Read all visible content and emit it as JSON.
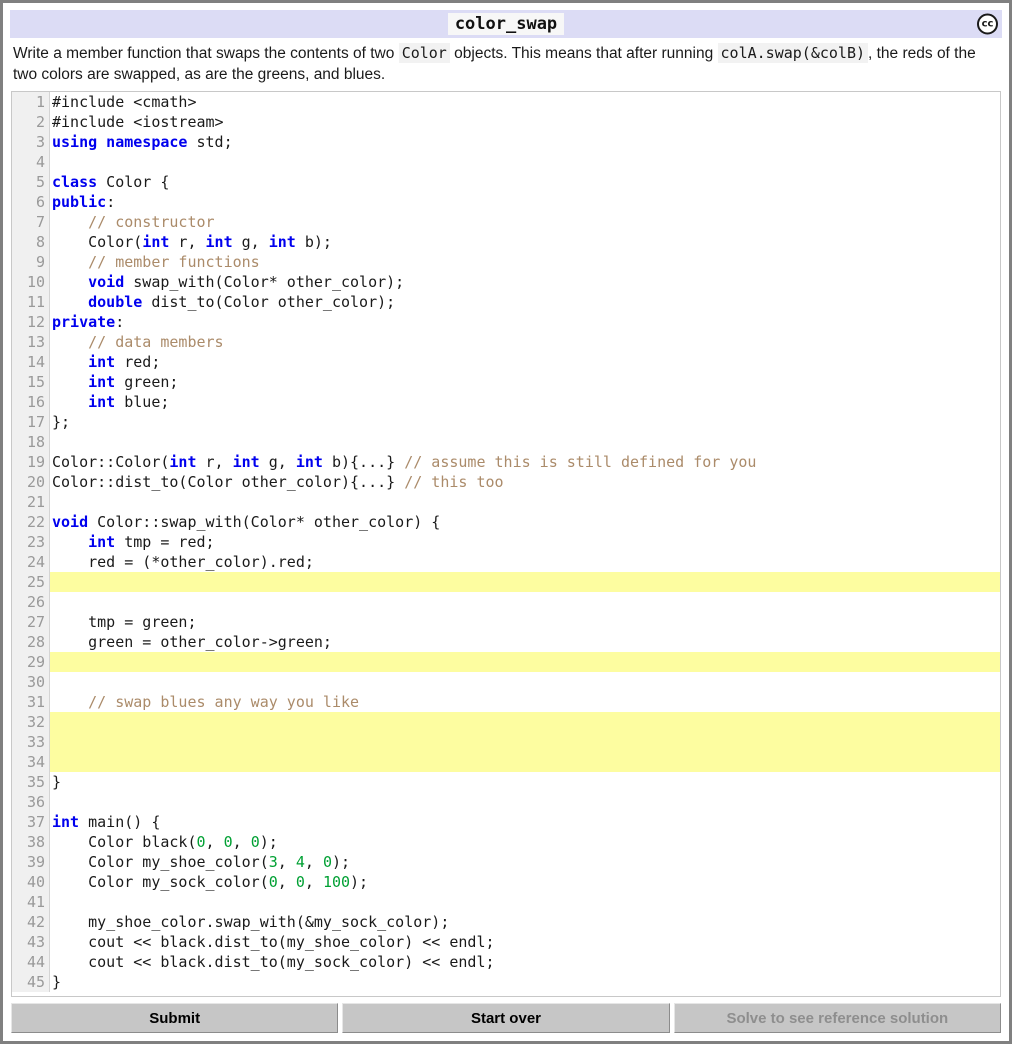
{
  "window": {
    "title": "color_swap",
    "license_badge": "cc"
  },
  "prompt": {
    "part1": "Write a member function that swaps the contents of two ",
    "code1": "Color",
    "part2": " objects. This means that after running ",
    "code2": "colA.swap(&colB)",
    "part3": ", the reds of the two colors are swapped, as are the greens, and blues."
  },
  "editor": {
    "language": "cpp",
    "first_line_number": 1,
    "total_lines": 45,
    "highlighted_lines": [
      25,
      29,
      32,
      33,
      34
    ],
    "highlight_color": "#fdfda0",
    "colors": {
      "keyword": "#0000ee",
      "comment": "#ab8b6a",
      "number": "#00a033",
      "plain": "#1a1a1a",
      "gutter_bg": "#f0f0f0",
      "gutter_fg": "#999999"
    },
    "lines": [
      {
        "n": 1,
        "editable": false,
        "tokens": [
          {
            "t": "pln",
            "v": "#include <cmath>"
          }
        ]
      },
      {
        "n": 2,
        "editable": false,
        "tokens": [
          {
            "t": "pln",
            "v": "#include <iostream>"
          }
        ]
      },
      {
        "n": 3,
        "editable": false,
        "tokens": [
          {
            "t": "kw",
            "v": "using namespace"
          },
          {
            "t": "pln",
            "v": " std;"
          }
        ]
      },
      {
        "n": 4,
        "editable": false,
        "tokens": []
      },
      {
        "n": 5,
        "editable": false,
        "tokens": [
          {
            "t": "kw",
            "v": "class"
          },
          {
            "t": "pln",
            "v": " Color {"
          }
        ]
      },
      {
        "n": 6,
        "editable": false,
        "tokens": [
          {
            "t": "kw",
            "v": "public"
          },
          {
            "t": "pln",
            "v": ":"
          }
        ]
      },
      {
        "n": 7,
        "editable": false,
        "tokens": [
          {
            "t": "pln",
            "v": "    "
          },
          {
            "t": "com",
            "v": "// constructor"
          }
        ]
      },
      {
        "n": 8,
        "editable": false,
        "tokens": [
          {
            "t": "pln",
            "v": "    Color("
          },
          {
            "t": "kw",
            "v": "int"
          },
          {
            "t": "pln",
            "v": " r, "
          },
          {
            "t": "kw",
            "v": "int"
          },
          {
            "t": "pln",
            "v": " g, "
          },
          {
            "t": "kw",
            "v": "int"
          },
          {
            "t": "pln",
            "v": " b);"
          }
        ]
      },
      {
        "n": 9,
        "editable": false,
        "tokens": [
          {
            "t": "pln",
            "v": "    "
          },
          {
            "t": "com",
            "v": "// member functions"
          }
        ]
      },
      {
        "n": 10,
        "editable": false,
        "tokens": [
          {
            "t": "pln",
            "v": "    "
          },
          {
            "t": "kw",
            "v": "void"
          },
          {
            "t": "pln",
            "v": " swap_with(Color* other_color);"
          }
        ]
      },
      {
        "n": 11,
        "editable": false,
        "tokens": [
          {
            "t": "pln",
            "v": "    "
          },
          {
            "t": "kw",
            "v": "double"
          },
          {
            "t": "pln",
            "v": " dist_to(Color other_color);"
          }
        ]
      },
      {
        "n": 12,
        "editable": false,
        "tokens": [
          {
            "t": "kw",
            "v": "private"
          },
          {
            "t": "pln",
            "v": ":"
          }
        ]
      },
      {
        "n": 13,
        "editable": false,
        "tokens": [
          {
            "t": "pln",
            "v": "    "
          },
          {
            "t": "com",
            "v": "// data members"
          }
        ]
      },
      {
        "n": 14,
        "editable": false,
        "tokens": [
          {
            "t": "pln",
            "v": "    "
          },
          {
            "t": "kw",
            "v": "int"
          },
          {
            "t": "pln",
            "v": " red;"
          }
        ]
      },
      {
        "n": 15,
        "editable": false,
        "tokens": [
          {
            "t": "pln",
            "v": "    "
          },
          {
            "t": "kw",
            "v": "int"
          },
          {
            "t": "pln",
            "v": " green;"
          }
        ]
      },
      {
        "n": 16,
        "editable": false,
        "tokens": [
          {
            "t": "pln",
            "v": "    "
          },
          {
            "t": "kw",
            "v": "int"
          },
          {
            "t": "pln",
            "v": " blue;"
          }
        ]
      },
      {
        "n": 17,
        "editable": false,
        "tokens": [
          {
            "t": "pln",
            "v": "};"
          }
        ]
      },
      {
        "n": 18,
        "editable": false,
        "tokens": []
      },
      {
        "n": 19,
        "editable": false,
        "tokens": [
          {
            "t": "pln",
            "v": "Color::Color("
          },
          {
            "t": "kw",
            "v": "int"
          },
          {
            "t": "pln",
            "v": " r, "
          },
          {
            "t": "kw",
            "v": "int"
          },
          {
            "t": "pln",
            "v": " g, "
          },
          {
            "t": "kw",
            "v": "int"
          },
          {
            "t": "pln",
            "v": " b){...} "
          },
          {
            "t": "com",
            "v": "// assume this is still defined for you"
          }
        ]
      },
      {
        "n": 20,
        "editable": false,
        "tokens": [
          {
            "t": "pln",
            "v": "Color::dist_to(Color other_color){...} "
          },
          {
            "t": "com",
            "v": "// this too"
          }
        ]
      },
      {
        "n": 21,
        "editable": false,
        "tokens": []
      },
      {
        "n": 22,
        "editable": false,
        "tokens": [
          {
            "t": "kw",
            "v": "void"
          },
          {
            "t": "pln",
            "v": " Color::swap_with(Color* other_color) {"
          }
        ]
      },
      {
        "n": 23,
        "editable": false,
        "tokens": [
          {
            "t": "pln",
            "v": "    "
          },
          {
            "t": "kw",
            "v": "int"
          },
          {
            "t": "pln",
            "v": " tmp = red;"
          }
        ]
      },
      {
        "n": 24,
        "editable": false,
        "tokens": [
          {
            "t": "pln",
            "v": "    red = (*other_color).red;"
          }
        ]
      },
      {
        "n": 25,
        "editable": true,
        "tokens": []
      },
      {
        "n": 26,
        "editable": false,
        "tokens": []
      },
      {
        "n": 27,
        "editable": false,
        "tokens": [
          {
            "t": "pln",
            "v": "    tmp = green;"
          }
        ]
      },
      {
        "n": 28,
        "editable": false,
        "tokens": [
          {
            "t": "pln",
            "v": "    green = other_color->green;"
          }
        ]
      },
      {
        "n": 29,
        "editable": true,
        "tokens": []
      },
      {
        "n": 30,
        "editable": false,
        "tokens": []
      },
      {
        "n": 31,
        "editable": false,
        "tokens": [
          {
            "t": "pln",
            "v": "    "
          },
          {
            "t": "com",
            "v": "// swap blues any way you like"
          }
        ]
      },
      {
        "n": 32,
        "editable": true,
        "tokens": []
      },
      {
        "n": 33,
        "editable": true,
        "tokens": []
      },
      {
        "n": 34,
        "editable": true,
        "tokens": []
      },
      {
        "n": 35,
        "editable": false,
        "tokens": [
          {
            "t": "pln",
            "v": "}"
          }
        ]
      },
      {
        "n": 36,
        "editable": false,
        "tokens": []
      },
      {
        "n": 37,
        "editable": false,
        "tokens": [
          {
            "t": "kw",
            "v": "int"
          },
          {
            "t": "pln",
            "v": " main() {"
          }
        ]
      },
      {
        "n": 38,
        "editable": false,
        "tokens": [
          {
            "t": "pln",
            "v": "    Color black("
          },
          {
            "t": "num",
            "v": "0"
          },
          {
            "t": "pln",
            "v": ", "
          },
          {
            "t": "num",
            "v": "0"
          },
          {
            "t": "pln",
            "v": ", "
          },
          {
            "t": "num",
            "v": "0"
          },
          {
            "t": "pln",
            "v": ");"
          }
        ]
      },
      {
        "n": 39,
        "editable": false,
        "tokens": [
          {
            "t": "pln",
            "v": "    Color my_shoe_color("
          },
          {
            "t": "num",
            "v": "3"
          },
          {
            "t": "pln",
            "v": ", "
          },
          {
            "t": "num",
            "v": "4"
          },
          {
            "t": "pln",
            "v": ", "
          },
          {
            "t": "num",
            "v": "0"
          },
          {
            "t": "pln",
            "v": ");"
          }
        ]
      },
      {
        "n": 40,
        "editable": false,
        "tokens": [
          {
            "t": "pln",
            "v": "    Color my_sock_color("
          },
          {
            "t": "num",
            "v": "0"
          },
          {
            "t": "pln",
            "v": ", "
          },
          {
            "t": "num",
            "v": "0"
          },
          {
            "t": "pln",
            "v": ", "
          },
          {
            "t": "num",
            "v": "100"
          },
          {
            "t": "pln",
            "v": ");"
          }
        ]
      },
      {
        "n": 41,
        "editable": false,
        "tokens": []
      },
      {
        "n": 42,
        "editable": false,
        "tokens": [
          {
            "t": "pln",
            "v": "    my_shoe_color.swap_with(&my_sock_color);"
          }
        ]
      },
      {
        "n": 43,
        "editable": false,
        "tokens": [
          {
            "t": "pln",
            "v": "    cout << black.dist_to(my_shoe_color) << endl;"
          }
        ]
      },
      {
        "n": 44,
        "editable": false,
        "tokens": [
          {
            "t": "pln",
            "v": "    cout << black.dist_to(my_sock_color) << endl;"
          }
        ]
      },
      {
        "n": 45,
        "editable": false,
        "tokens": [
          {
            "t": "pln",
            "v": "}"
          }
        ]
      }
    ]
  },
  "buttons": [
    {
      "label": "Submit",
      "disabled": false
    },
    {
      "label": "Start over",
      "disabled": false
    },
    {
      "label": "Solve to see reference solution",
      "disabled": true
    }
  ]
}
